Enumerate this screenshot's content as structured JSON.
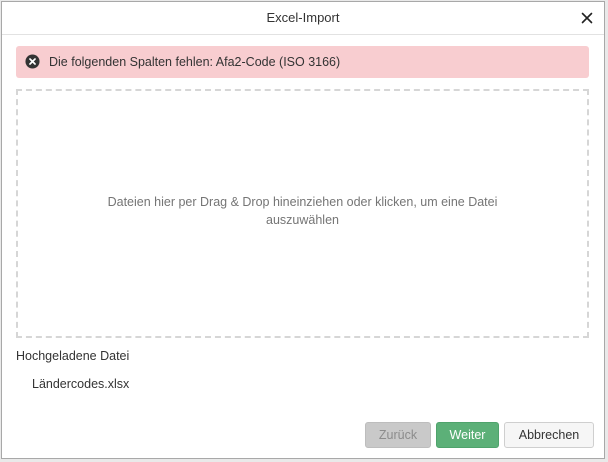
{
  "dialog": {
    "title": "Excel-Import",
    "close_icon": "close-x-icon"
  },
  "alert": {
    "icon": "error-x-circle-icon",
    "message": "Die folgenden Spalten fehlen: Afa2-Code (ISO 3166)",
    "background": "#f8cdd0"
  },
  "dropzone": {
    "text": "Dateien hier per Drag & Drop hineinziehen oder klicken, um eine Datei auszuwählen"
  },
  "uploaded": {
    "label": "Hochgeladene Datei",
    "file_name": "Ländercodes.xlsx"
  },
  "buttons": {
    "back": "Zurück",
    "next": "Weiter",
    "cancel": "Abbrechen"
  },
  "colors": {
    "next_button": "#5cb078",
    "back_button_disabled": "#c9c9c9"
  }
}
